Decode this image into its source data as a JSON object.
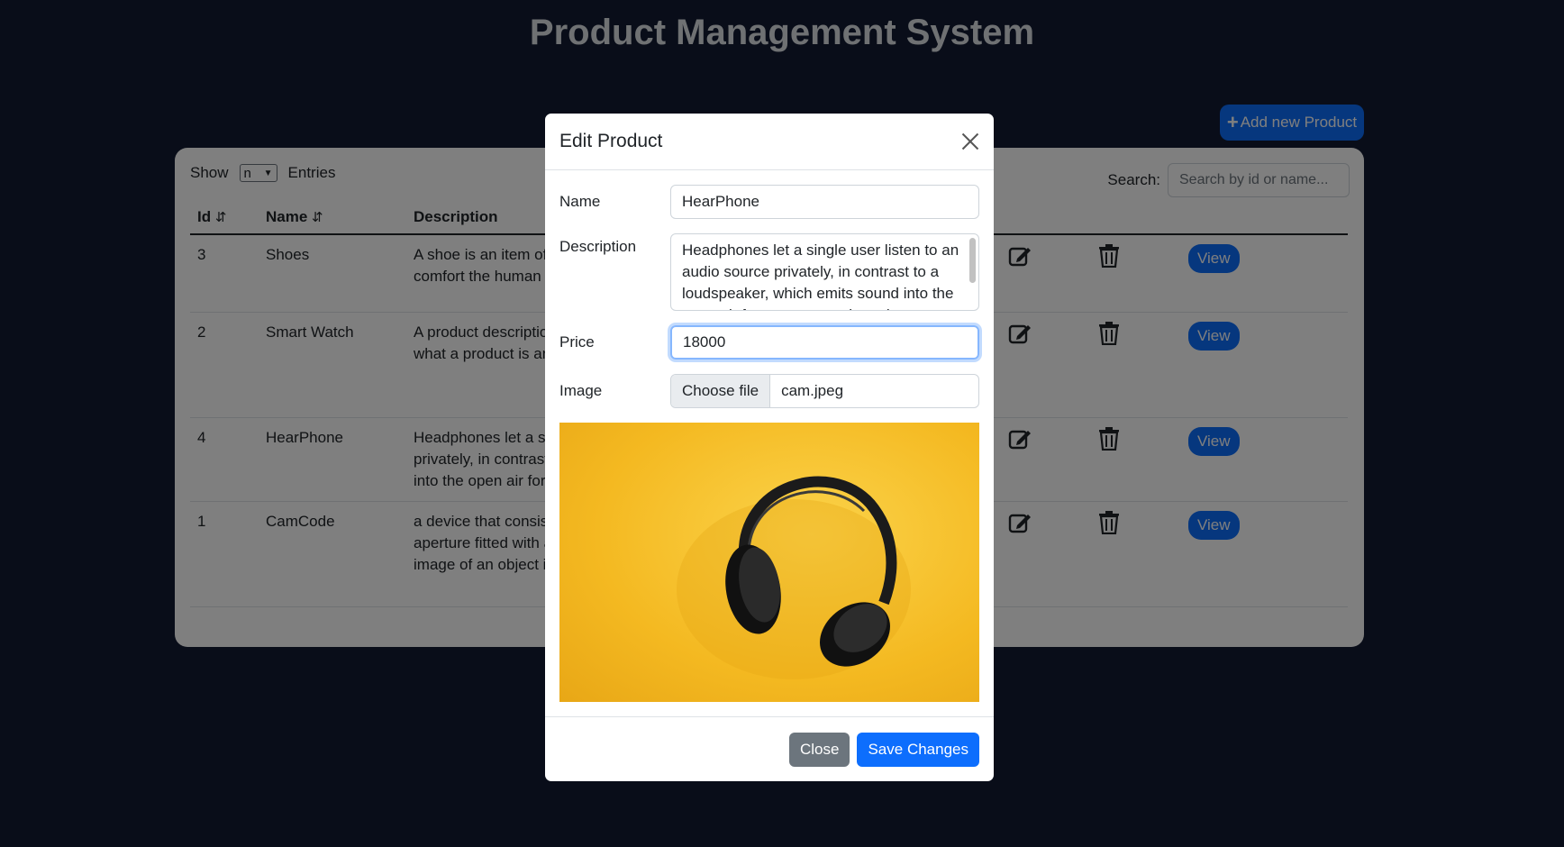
{
  "page": {
    "title": "Product Management System"
  },
  "toolbar": {
    "add_label": "Add new Product",
    "add_icon": "plus-icon"
  },
  "table_controls": {
    "show_label": "Show",
    "entries_select_value": "n",
    "entries_label": "Entries",
    "search_label": "Search:",
    "search_placeholder": "Search by id or name..."
  },
  "table": {
    "columns": [
      "Id",
      "Name",
      "Description"
    ],
    "rows": [
      {
        "id": "3",
        "name": "Shoes",
        "description": [
          "A shoe is an item of",
          "comfort the human f"
        ],
        "view_label": "View"
      },
      {
        "id": "2",
        "name": "Smart Watch",
        "description": [
          "A product descriptio",
          "what a product is an"
        ],
        "view_label": "View"
      },
      {
        "id": "4",
        "name": "HearPhone",
        "description": [
          "Headphones let a sin",
          "privately, in contrast",
          "into the open air for"
        ],
        "view_label": "View"
      },
      {
        "id": "1",
        "name": "CamCode",
        "description": [
          "a device that consis",
          "aperture fitted with a",
          "image of an object is"
        ],
        "view_label": "View"
      }
    ]
  },
  "modal": {
    "title": "Edit Product",
    "name_label": "Name",
    "name_value": "HearPhone",
    "description_label": "Description",
    "description_value": "Headphones let a single user listen to an audio source privately, in contrast to a loudspeaker, which emits sound into the open air for anyone nearby to hear.",
    "price_label": "Price",
    "price_value": "18000",
    "image_label": "Image",
    "file_button_label": "Choose file",
    "file_name": "cam.jpeg",
    "close_label": "Close",
    "save_label": "Save Changes"
  },
  "colors": {
    "primary": "#0d6efd",
    "secondary": "#6c757d",
    "background": "#121a33",
    "preview_yellow": "#f4b921"
  }
}
